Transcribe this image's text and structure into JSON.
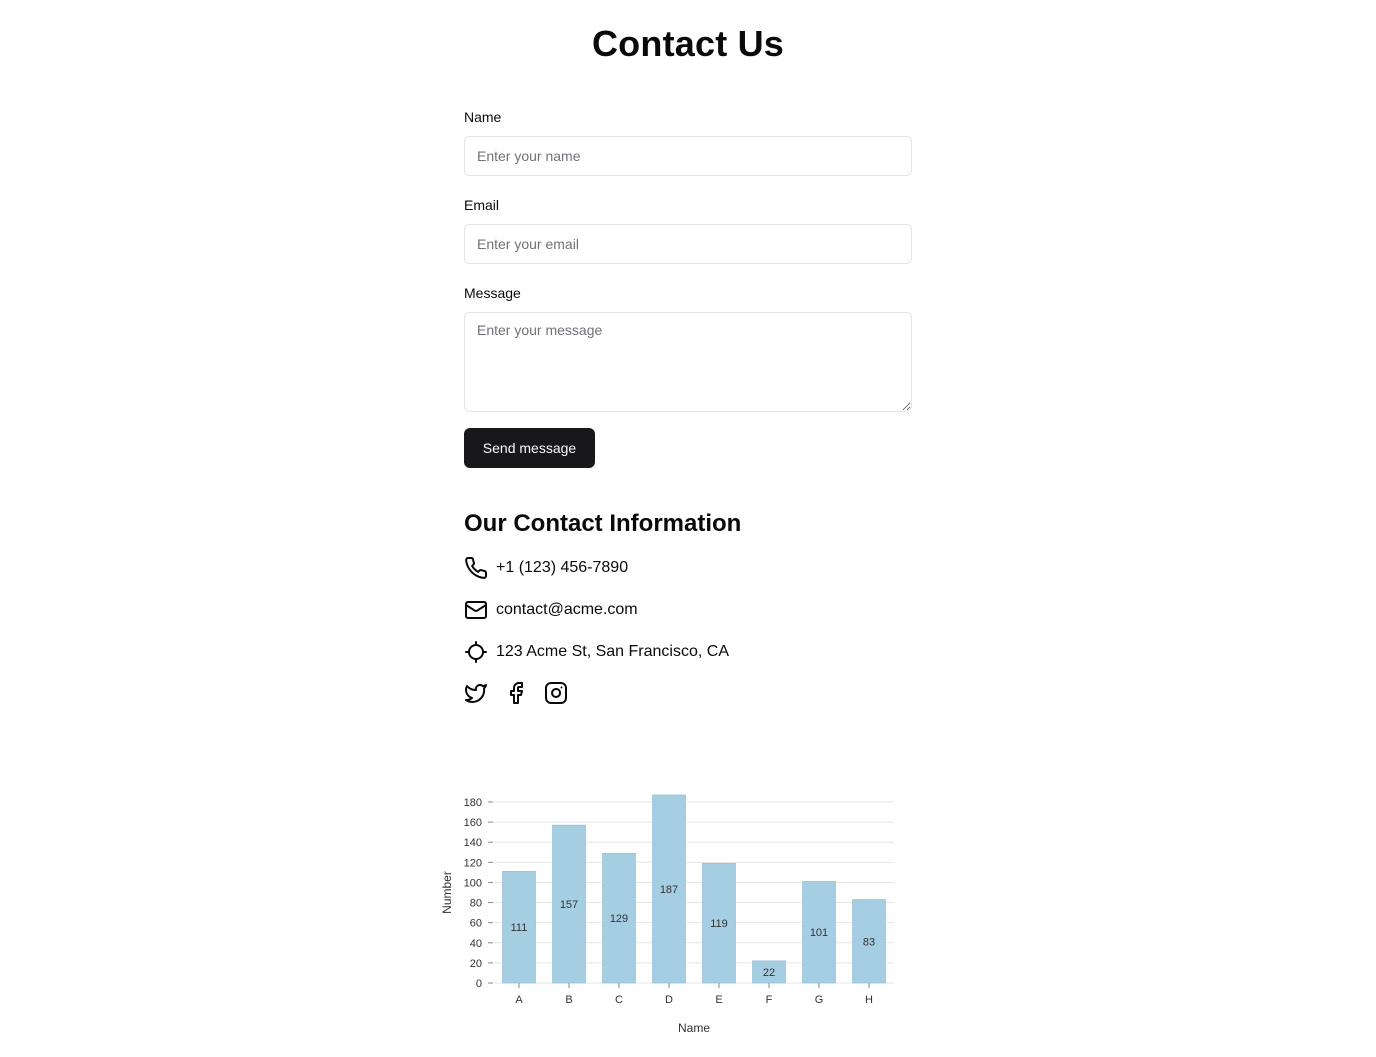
{
  "page": {
    "title": "Contact Us"
  },
  "form": {
    "name_label": "Name",
    "name_placeholder": "Enter your name",
    "email_label": "Email",
    "email_placeholder": "Enter your email",
    "message_label": "Message",
    "message_placeholder": "Enter your message",
    "submit_label": "Send message"
  },
  "contact_info": {
    "title": "Our Contact Information",
    "phone": "+1 (123) 456-7890",
    "email": "contact@acme.com",
    "address": "123 Acme St, San Francisco, CA",
    "icons": [
      "phone-icon",
      "mail-icon",
      "locate-icon"
    ],
    "socials": [
      "twitter-icon",
      "facebook-icon",
      "instagram-icon"
    ]
  },
  "colors": {
    "button_bg": "#18181b",
    "bar_fill": "#a6cee3"
  },
  "chart_data": {
    "type": "bar",
    "categories": [
      "A",
      "B",
      "C",
      "D",
      "E",
      "F",
      "G",
      "H"
    ],
    "values": [
      111,
      157,
      129,
      187,
      119,
      22,
      101,
      83
    ],
    "title": "",
    "xlabel": "Name",
    "ylabel": "Number",
    "ylim": [
      0,
      180
    ],
    "yticks": [
      0,
      20,
      40,
      60,
      80,
      100,
      120,
      140,
      160,
      180
    ],
    "grid": true,
    "data_labels": true
  }
}
